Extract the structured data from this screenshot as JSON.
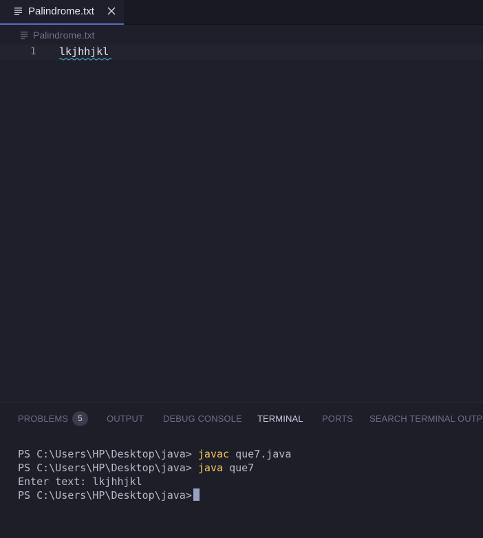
{
  "editor_tab": {
    "title": "Palindrome.txt",
    "icon": "text-lines-icon",
    "close_icon": "close-icon"
  },
  "breadcrumb": {
    "file": "Palindrome.txt",
    "icon": "text-lines-icon"
  },
  "editor": {
    "lines": [
      {
        "number": "1",
        "text": "lkjhhjkl"
      }
    ]
  },
  "panel": {
    "tabs": [
      {
        "label": "PROBLEMS",
        "badge": "5",
        "active": false
      },
      {
        "label": "OUTPUT",
        "active": false
      },
      {
        "label": "DEBUG CONSOLE",
        "active": false
      },
      {
        "label": "TERMINAL",
        "active": true
      },
      {
        "label": "PORTS",
        "active": false
      },
      {
        "label": "SEARCH TERMINAL OUTPUT",
        "active": false
      }
    ]
  },
  "terminal": {
    "prompt": "PS C:\\Users\\HP\\Desktop\\java>",
    "lines": [
      {
        "command": "javac",
        "args": "que7.java"
      },
      {
        "command": "java",
        "args": "que7"
      },
      {
        "output": "Enter text: lkjhhjkl"
      }
    ]
  },
  "colors": {
    "background": "#1e1f2b",
    "accent": "#5b6bb8",
    "command": "#f3c35b",
    "squiggle": "#3fb3c9"
  }
}
